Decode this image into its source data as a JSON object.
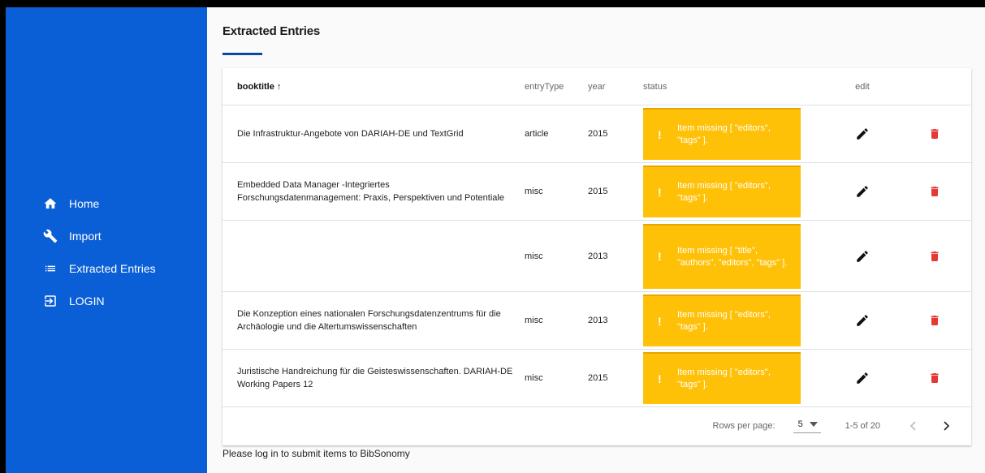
{
  "sidebar": {
    "items": [
      {
        "label": "Home",
        "icon": "home-icon"
      },
      {
        "label": "Import",
        "icon": "wrench-icon"
      },
      {
        "label": "Extracted Entries",
        "icon": "list-icon"
      },
      {
        "label": "LOGIN",
        "icon": "login-icon"
      }
    ]
  },
  "main": {
    "title": "Extracted Entries",
    "note": "Please log in to submit items to BibSonomy"
  },
  "table": {
    "headers": {
      "booktitle": "booktitle",
      "sort_arrow": "↑",
      "entryType": "entryType",
      "year": "year",
      "status": "status",
      "edit": "edit"
    },
    "rows": [
      {
        "booktitle": "Die Infrastruktur-Angebote von DARIAH-DE und TextGrid",
        "entryType": "article",
        "year": "2015",
        "status": "Item missing [ \"editors\", \"tags\" ].",
        "warn": "!"
      },
      {
        "booktitle": "Embedded Data Manager -Integriertes Forschungsdatenmanagement: Praxis, Perspektiven und Potentiale",
        "entryType": "misc",
        "year": "2015",
        "status": "Item missing [ \"editors\", \"tags\" ].",
        "warn": "!"
      },
      {
        "booktitle": "",
        "entryType": "misc",
        "year": "2013",
        "status": "Item missing [ \"title\", \"authors\", \"editors\", \"tags\" ].",
        "warn": "!"
      },
      {
        "booktitle": "Die Konzeption eines nationalen Forschungsdatenzentrums für die Archäologie und die Altertumswissenschaften",
        "entryType": "misc",
        "year": "2013",
        "status": "Item missing [ \"editors\", \"tags\" ].",
        "warn": "!"
      },
      {
        "booktitle": "Juristische Handreichung für die Geisteswissenschaften. DARIAH-DE Working Papers 12",
        "entryType": "misc",
        "year": "2015",
        "status": "Item missing [ \"editors\", \"tags\" ].",
        "warn": "!"
      }
    ],
    "footer": {
      "rows_per_page_label": "Rows per page:",
      "rows_per_page_value": "5",
      "range": "1-5 of 20"
    }
  },
  "colors": {
    "sidebar": "#0a5fd6",
    "status_warning": "#ffc107",
    "delete": "#e53935",
    "accent": "#0d47a1"
  }
}
